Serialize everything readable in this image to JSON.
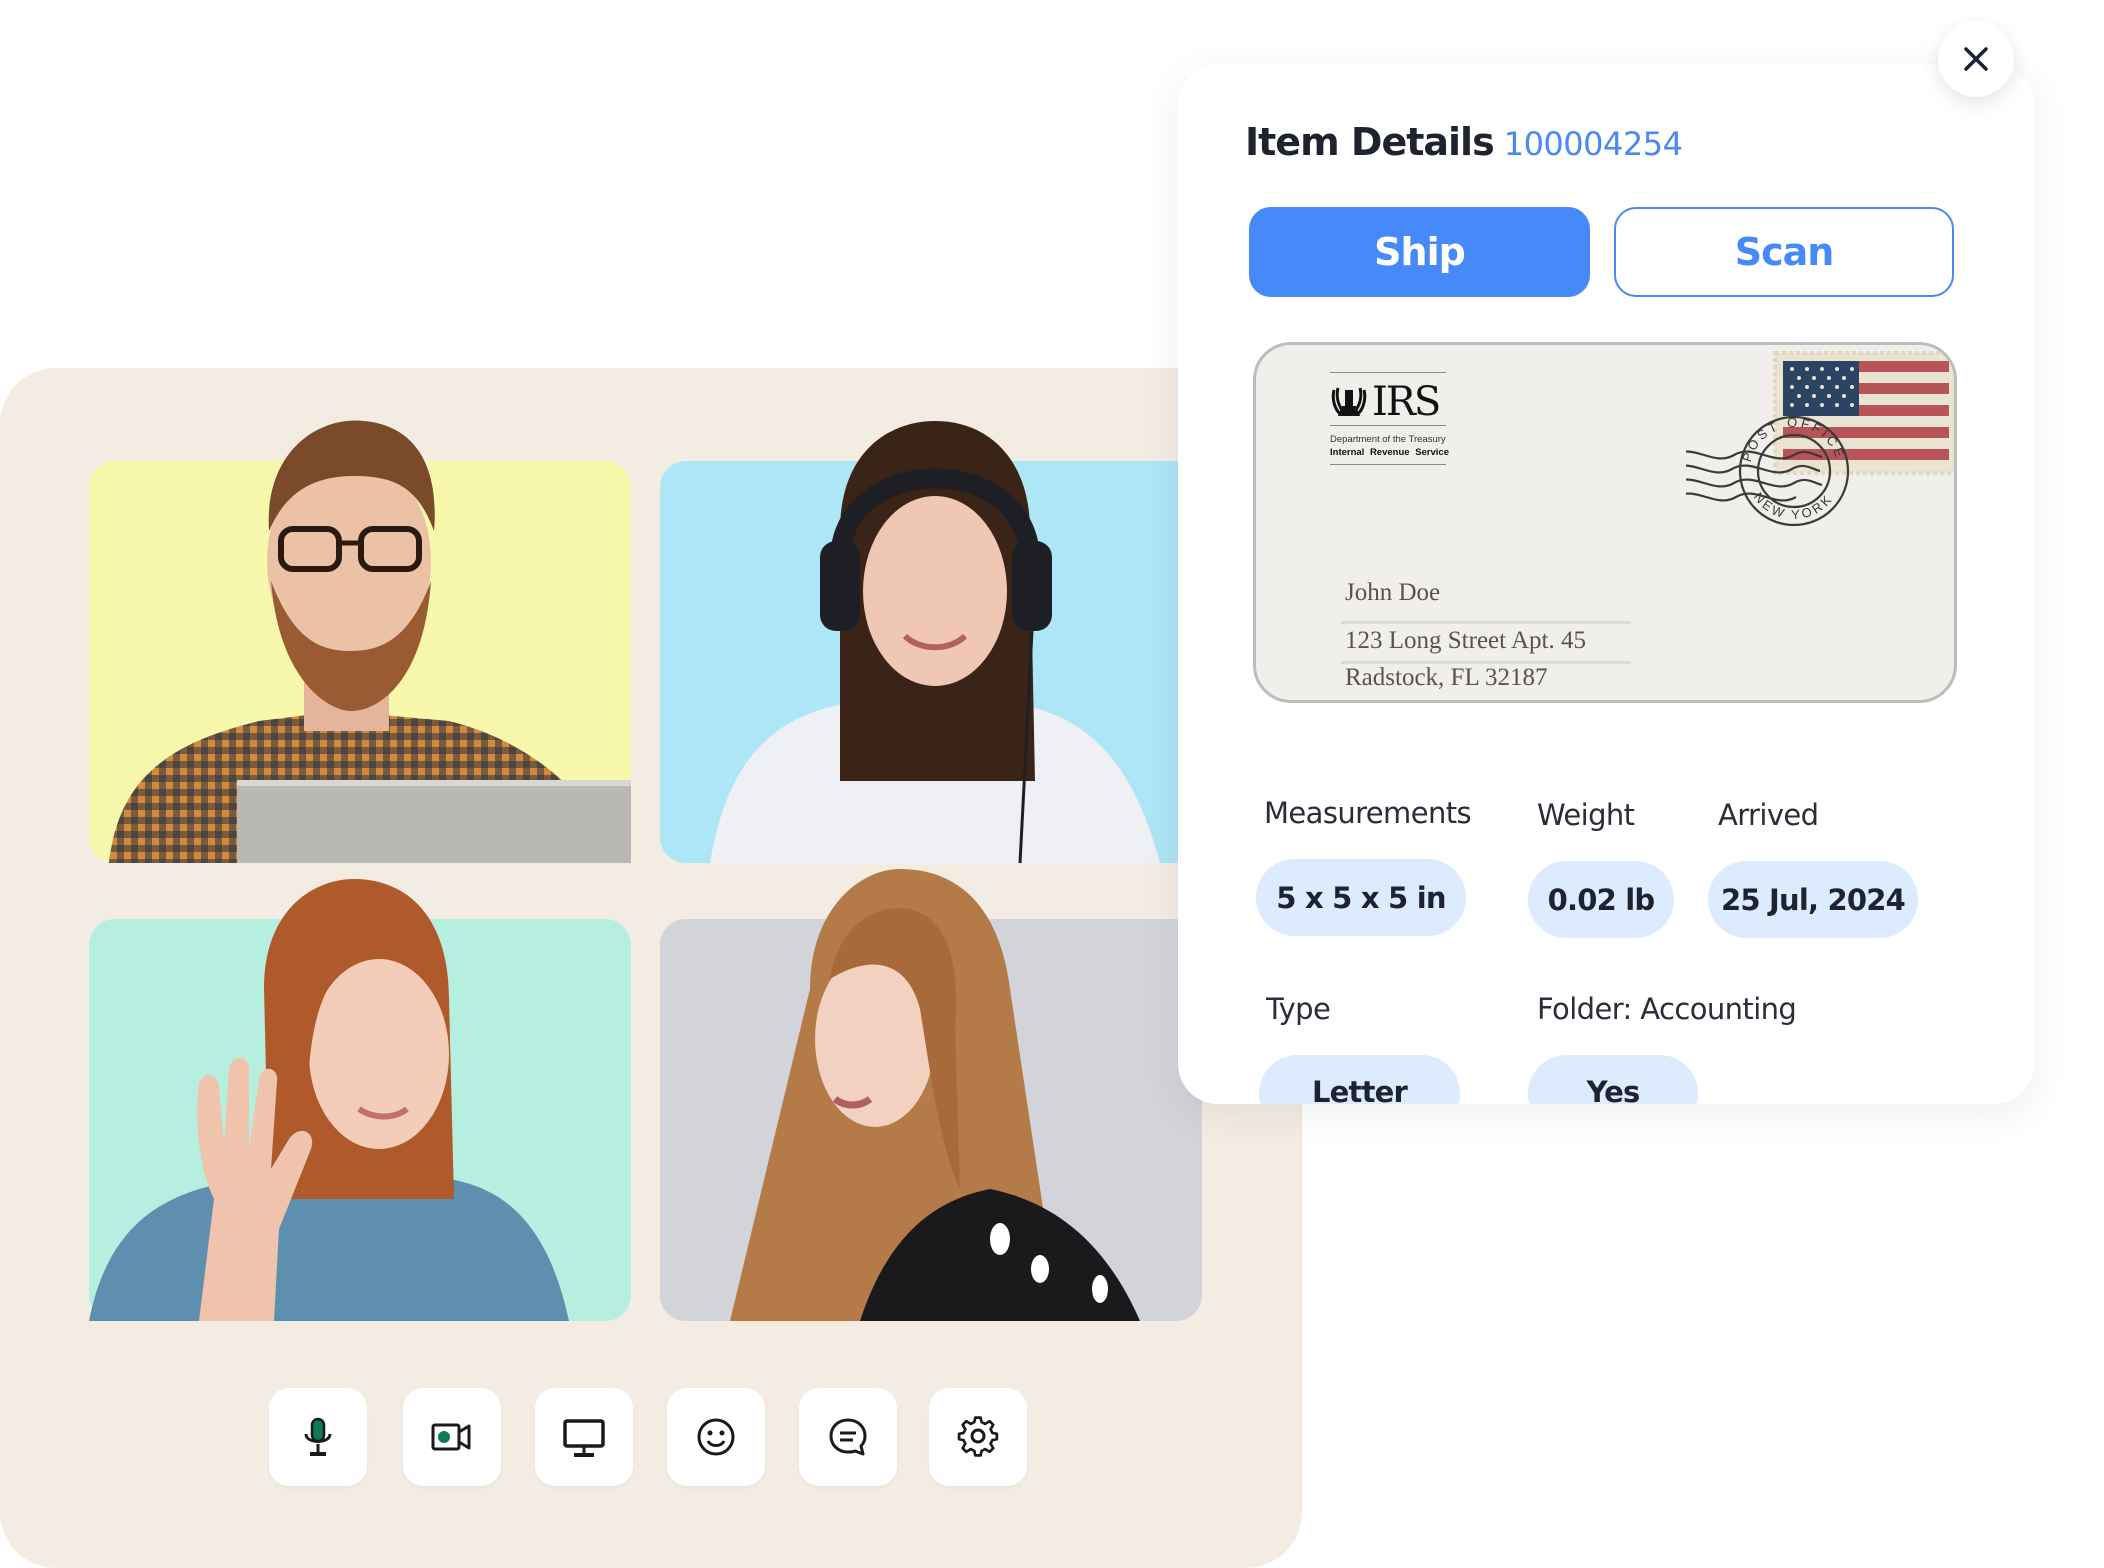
{
  "call": {
    "participants": [
      {
        "name": "participant-man-glasses",
        "tile_color": "#f8f8ac"
      },
      {
        "name": "participant-woman-headphones",
        "tile_color": "#ade6f6"
      },
      {
        "name": "participant-woman-waving",
        "tile_color": "#b6efe0"
      },
      {
        "name": "participant-woman-long-hair",
        "tile_color": "#d3d4da"
      }
    ],
    "toolbar": [
      {
        "id": "microphone",
        "icon": "microphone-icon"
      },
      {
        "id": "camera",
        "icon": "video-camera-icon"
      },
      {
        "id": "screen-share",
        "icon": "monitor-icon"
      },
      {
        "id": "reactions",
        "icon": "smiley-icon"
      },
      {
        "id": "chat",
        "icon": "chat-bubble-icon"
      },
      {
        "id": "settings",
        "icon": "gear-icon"
      }
    ],
    "accent_color": "#0f7a5a"
  },
  "panel": {
    "title": "Item Details",
    "item_id": "100004254",
    "actions": {
      "ship_label": "Ship",
      "scan_label": "Scan"
    },
    "envelope": {
      "sender": {
        "logo": "IRS",
        "department": "Department of the Treasury",
        "service": "Internal Revenue Service"
      },
      "postmark": {
        "top_text": "POST OFFICE",
        "bottom_text": "NEW YORK"
      },
      "recipient": {
        "name": "John Doe",
        "street": "123 Long Street Apt. 45",
        "city_line": "Radstock, FL 32187"
      }
    },
    "fields": {
      "measurements": {
        "label": "Measurements",
        "value": "5 x 5 x 5 in"
      },
      "weight": {
        "label": "Weight",
        "value": "0.02 lb"
      },
      "arrived": {
        "label": "Arrived",
        "value": "25 Jul, 2024"
      },
      "type": {
        "label": "Type",
        "value": "Letter"
      },
      "folder": {
        "label": "Folder: Accounting",
        "value": "Yes"
      }
    },
    "colors": {
      "primary": "#4689f8",
      "pill_bg": "#dcebfd",
      "text": "#1f2330"
    }
  }
}
